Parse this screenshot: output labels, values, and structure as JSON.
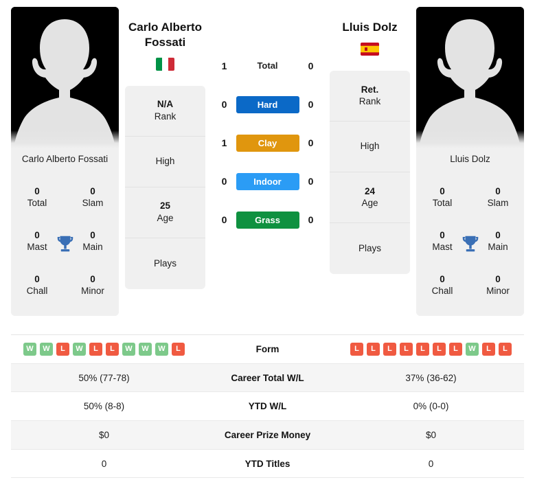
{
  "players": {
    "left": {
      "name_line1": "Carlo Alberto",
      "name_line2": "Fossati",
      "full_name": "Carlo Alberto Fossati",
      "photo_caption": "Carlo Alberto Fossati",
      "flag": "italy-flag",
      "rank_value": "N/A",
      "rank_label": "Rank",
      "high_value": "",
      "high_label": "High",
      "age_value": "25",
      "age_label": "Age",
      "plays_value": "",
      "plays_label": "Plays",
      "titles": {
        "total_value": "0",
        "total_label": "Total",
        "slam_value": "0",
        "slam_label": "Slam",
        "mast_value": "0",
        "mast_label": "Mast",
        "main_value": "0",
        "main_label": "Main",
        "chall_value": "0",
        "chall_label": "Chall",
        "minor_value": "0",
        "minor_label": "Minor"
      },
      "form": [
        "W",
        "W",
        "L",
        "W",
        "L",
        "L",
        "W",
        "W",
        "W",
        "L"
      ],
      "career_total_wl": "50% (77-78)",
      "ytd_wl": "50% (8-8)",
      "career_prize_money": "$0",
      "ytd_titles": "0"
    },
    "right": {
      "name_line1": "Lluis Dolz",
      "name_line2": "",
      "full_name": "Lluis Dolz",
      "photo_caption": "Lluis Dolz",
      "flag": "spain-flag",
      "rank_value": "Ret.",
      "rank_label": "Rank",
      "high_value": "",
      "high_label": "High",
      "age_value": "24",
      "age_label": "Age",
      "plays_value": "",
      "plays_label": "Plays",
      "titles": {
        "total_value": "0",
        "total_label": "Total",
        "slam_value": "0",
        "slam_label": "Slam",
        "mast_value": "0",
        "mast_label": "Mast",
        "main_value": "0",
        "main_label": "Main",
        "chall_value": "0",
        "chall_label": "Chall",
        "minor_value": "0",
        "minor_label": "Minor"
      },
      "form": [
        "L",
        "L",
        "L",
        "L",
        "L",
        "L",
        "L",
        "W",
        "L",
        "L"
      ],
      "career_total_wl": "37% (36-62)",
      "ytd_wl": "0% (0-0)",
      "career_prize_money": "$0",
      "ytd_titles": "0"
    }
  },
  "head_to_head": [
    {
      "label": "Total",
      "left": "1",
      "right": "0",
      "style": "plain",
      "color": ""
    },
    {
      "label": "Hard",
      "left": "0",
      "right": "0",
      "style": "pill",
      "color": "#0b69c7"
    },
    {
      "label": "Clay",
      "left": "1",
      "right": "0",
      "style": "pill",
      "color": "#e0960e"
    },
    {
      "label": "Indoor",
      "left": "0",
      "right": "0",
      "style": "pill",
      "color": "#2b9cf5"
    },
    {
      "label": "Grass",
      "left": "0",
      "right": "0",
      "style": "pill",
      "color": "#0f9140"
    }
  ],
  "stats_table": {
    "rows": [
      {
        "label": "Form",
        "type": "form",
        "left": "",
        "right": ""
      },
      {
        "label": "Career Total W/L",
        "type": "text",
        "left": "50% (77-78)",
        "right": "37% (36-62)"
      },
      {
        "label": "YTD W/L",
        "type": "text",
        "left": "50% (8-8)",
        "right": "0% (0-0)"
      },
      {
        "label": "Career Prize Money",
        "type": "text",
        "left": "$0",
        "right": "$0"
      },
      {
        "label": "YTD Titles",
        "type": "text",
        "left": "0",
        "right": "0"
      }
    ]
  },
  "colors": {
    "win_badge": "#7dc98a",
    "loss_badge": "#f05a41",
    "trophy": "#3a6fb5",
    "card_bg": "#f0f0f0",
    "row_alt_bg": "#f5f5f5"
  }
}
